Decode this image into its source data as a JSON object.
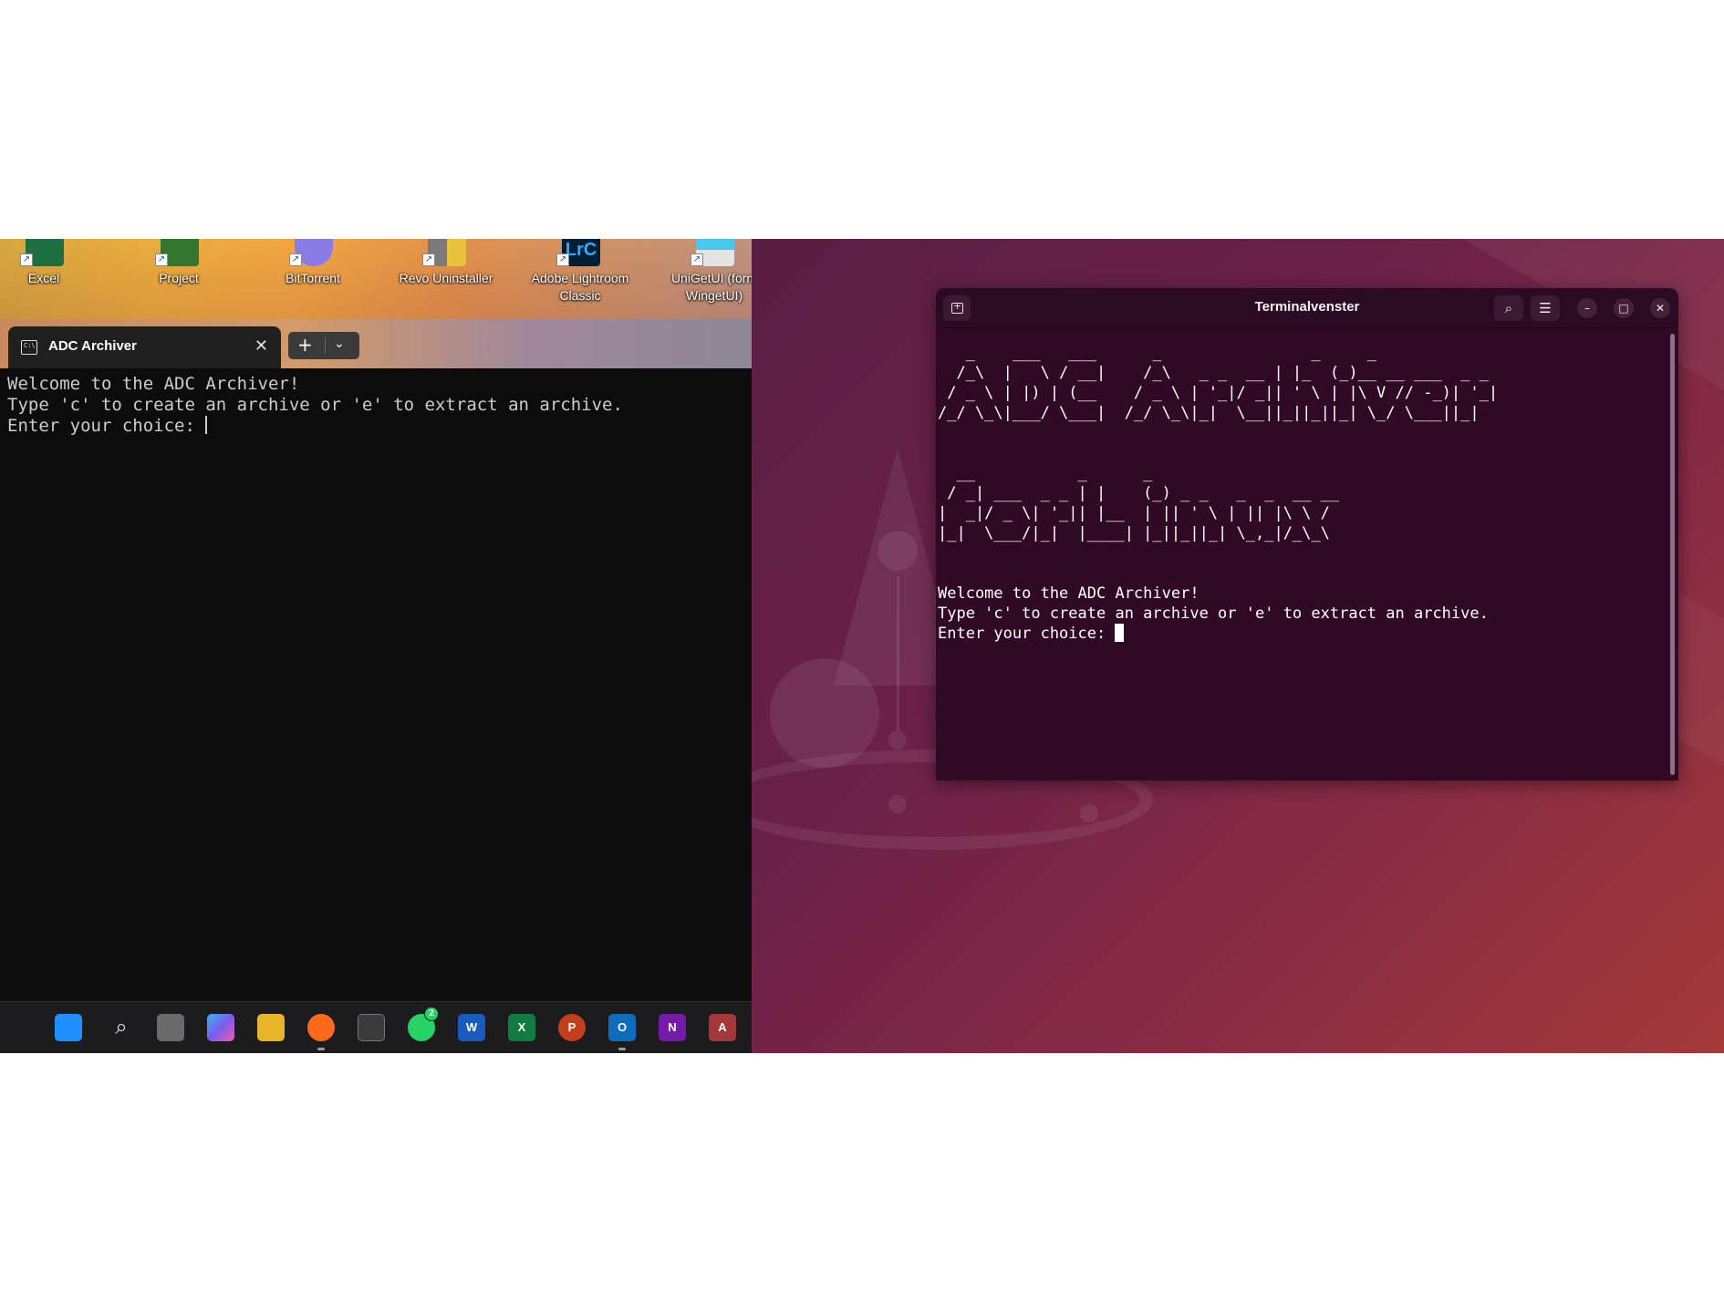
{
  "windows_desktop": {
    "icons": [
      {
        "label": "Excel",
        "icon": "excel-icon",
        "color": "#1d6f42"
      },
      {
        "label": "Project",
        "icon": "project-icon",
        "color": "#31752f"
      },
      {
        "label": "BitTorrent",
        "icon": "bittorrent-icon",
        "color": "#8a7be6"
      },
      {
        "label": "Revo Uninstaller",
        "icon": "revo-uninstaller-icon",
        "color": "#c7a63a"
      },
      {
        "label": "Adobe Lightroom Classic",
        "icon": "lightroom-icon",
        "color": "#001e36"
      },
      {
        "label": "UniGetUI (form WingetUI)",
        "icon": "unigetui-icon",
        "color": "#48c8f0"
      }
    ],
    "terminal": {
      "tab_title": "ADC Archiver",
      "lines": [
        "Welcome to the ADC Archiver!",
        "Type 'c' to create an archive or 'e' to extract an archive.",
        "Enter your choice: "
      ]
    },
    "taskbar": {
      "items": [
        {
          "name": "start-icon",
          "color": "#1e90ff",
          "text": ""
        },
        {
          "name": "search-icon",
          "color": "transparent",
          "text": ""
        },
        {
          "name": "task-view-icon",
          "color": "#6a6a6a",
          "text": ""
        },
        {
          "name": "copilot-icon",
          "color": "#7a5cf0",
          "text": ""
        },
        {
          "name": "file-explorer-icon",
          "color": "#e8b42a",
          "text": ""
        },
        {
          "name": "firefox-icon",
          "color": "#ff6a1a",
          "text": ""
        },
        {
          "name": "store-icon",
          "color": "#3a3a3a",
          "text": ""
        },
        {
          "name": "whatsapp-icon",
          "color": "#25d366",
          "text": "2"
        },
        {
          "name": "word-icon",
          "color": "#185abd",
          "text": "W"
        },
        {
          "name": "excel-icon",
          "color": "#107c41",
          "text": "X"
        },
        {
          "name": "powerpoint-icon",
          "color": "#c43e1c",
          "text": "P"
        },
        {
          "name": "outlook-icon",
          "color": "#0f6cbd",
          "text": "O"
        },
        {
          "name": "onenote-icon",
          "color": "#7719aa",
          "text": "N"
        },
        {
          "name": "access-icon",
          "color": "#a4373a",
          "text": "A"
        }
      ]
    }
  },
  "ubuntu_desktop": {
    "terminal": {
      "title": "Terminalvenster",
      "ascii_art": [
        "   _    ___   ___      _                _     _              ",
        "  /_\\  |   \\ / __|    /_\\   _ _  __ | |_  (_)__ __ ___  _ _ ",
        " / _ \\ | |) | (__    / _ \\ | '_|/ _|| ' \\ | |\\ V // -_)| '_|",
        "/_/ \\_\\|___/ \\___|  /_/ \\_\\|_|  \\__||_||_||_| \\_/ \\___||_|  ",
        "",
        "  __           _      _                      ",
        " / _| ___  _ _ | |    (_) _ _   _  _  __ __  ",
        "|  _|/ _ \\| '_|| |__  | || ' \\ | || |\\ \\ /  ",
        "|_|  \\___/|_|  |____| |_||_||_| \\_,_|/_\\_\\  "
      ],
      "lines": [
        "Welcome to the ADC Archiver!",
        "Type 'c' to create an archive or 'e' to extract an archive.",
        "Enter your choice: "
      ]
    }
  }
}
